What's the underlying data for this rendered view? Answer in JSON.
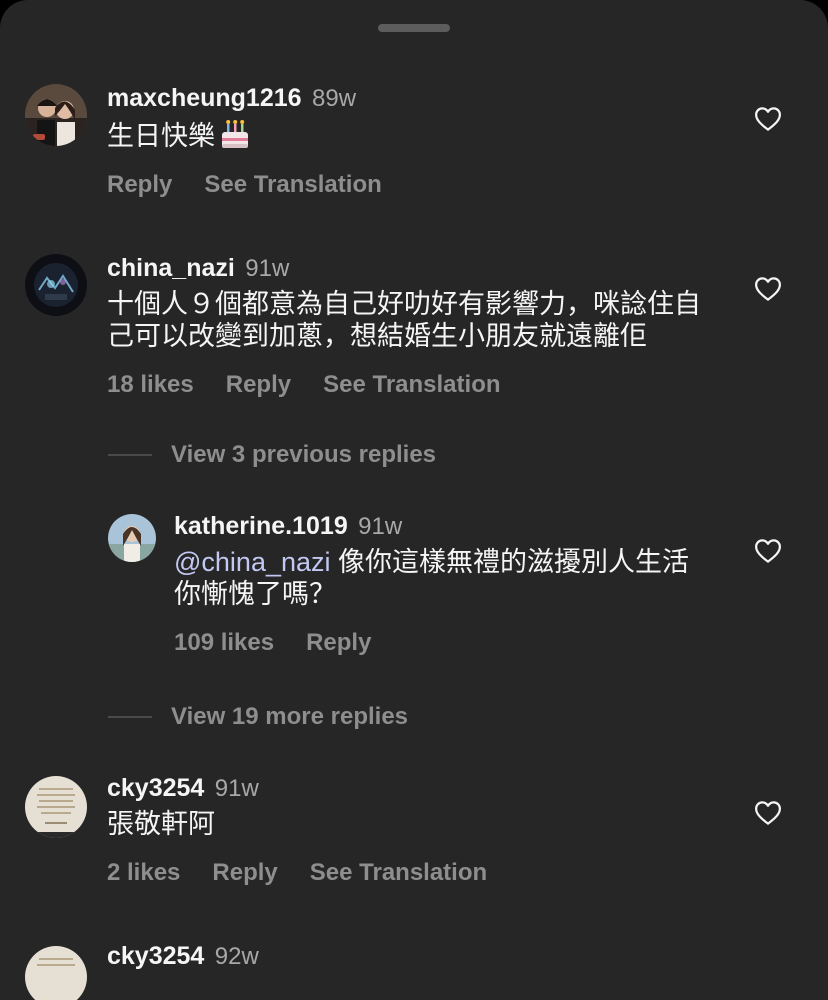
{
  "comments": [
    {
      "username": "maxcheung1216",
      "time": "89w",
      "text": "生日快樂",
      "emoji": "birthday-cake",
      "reply_label": "Reply",
      "translate_label": "See Translation"
    },
    {
      "username": "china_nazi",
      "time": "91w",
      "text": "十個人９個都意為自己好叻好有影響力，咪諗住自己可以改變到加蔥，想結婚生小朋友就遠離佢",
      "likes_label": "18 likes",
      "reply_label": "Reply",
      "translate_label": "See Translation"
    },
    {
      "username": "cky3254",
      "time": "91w",
      "text": "張敬軒阿",
      "likes_label": "2 likes",
      "reply_label": "Reply",
      "translate_label": "See Translation"
    },
    {
      "username": "cky3254",
      "time": "92w"
    }
  ],
  "thread": {
    "view_previous_label": "View 3 previous replies",
    "view_more_label": "View 19 more replies",
    "reply": {
      "username": "katherine.1019",
      "time": "91w",
      "mention": "@china_nazi",
      "text": "像你這樣無禮的滋擾別人生活 你慚愧了嗎？",
      "likes_label": "109 likes",
      "reply_label": "Reply"
    }
  },
  "colors": {
    "background": "#262626",
    "primary_text": "#f5f5f5",
    "secondary_text": "#8e8e8e",
    "mention": "#c2c8f2"
  }
}
